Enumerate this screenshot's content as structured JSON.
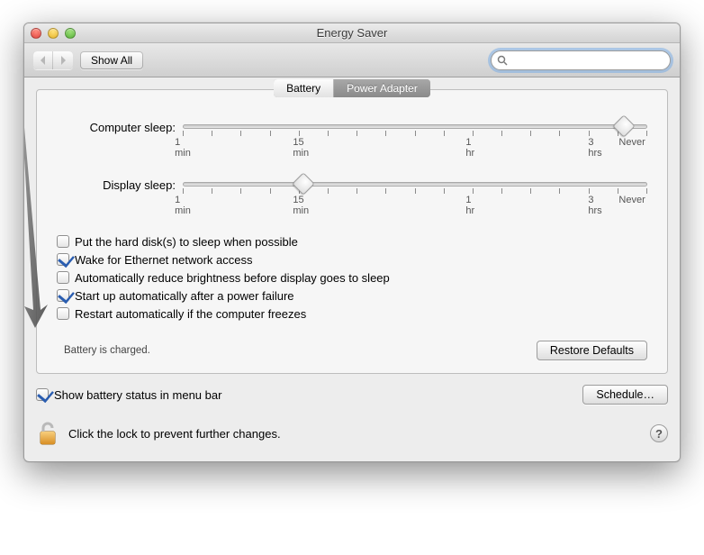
{
  "window": {
    "title": "Energy Saver"
  },
  "toolbar": {
    "show_all": "Show All",
    "search_placeholder": ""
  },
  "tabs": {
    "battery": "Battery",
    "power_adapter": "Power Adapter",
    "active": "battery"
  },
  "sliders": {
    "computer": {
      "label": "Computer sleep:",
      "value_pct": 95,
      "ticks": [
        "1 min",
        "15 min",
        "1 hr",
        "3 hrs",
        "Never"
      ]
    },
    "display": {
      "label": "Display sleep:",
      "value_pct": 26,
      "ticks": [
        "1 min",
        "15 min",
        "1 hr",
        "3 hrs",
        "Never"
      ]
    }
  },
  "checks": [
    {
      "label": "Put the hard disk(s) to sleep when possible",
      "checked": false
    },
    {
      "label": "Wake for Ethernet network access",
      "checked": true
    },
    {
      "label": "Automatically reduce brightness before display goes to sleep",
      "checked": false
    },
    {
      "label": "Start up automatically after a power failure",
      "checked": true
    },
    {
      "label": "Restart automatically if the computer freezes",
      "checked": false
    }
  ],
  "status": "Battery is charged.",
  "buttons": {
    "restore_defaults": "Restore Defaults",
    "schedule": "Schedule…"
  },
  "menubar_check": {
    "label": "Show battery status in menu bar",
    "checked": true
  },
  "lock_hint": "Click the lock to prevent further changes.",
  "help_glyph": "?"
}
